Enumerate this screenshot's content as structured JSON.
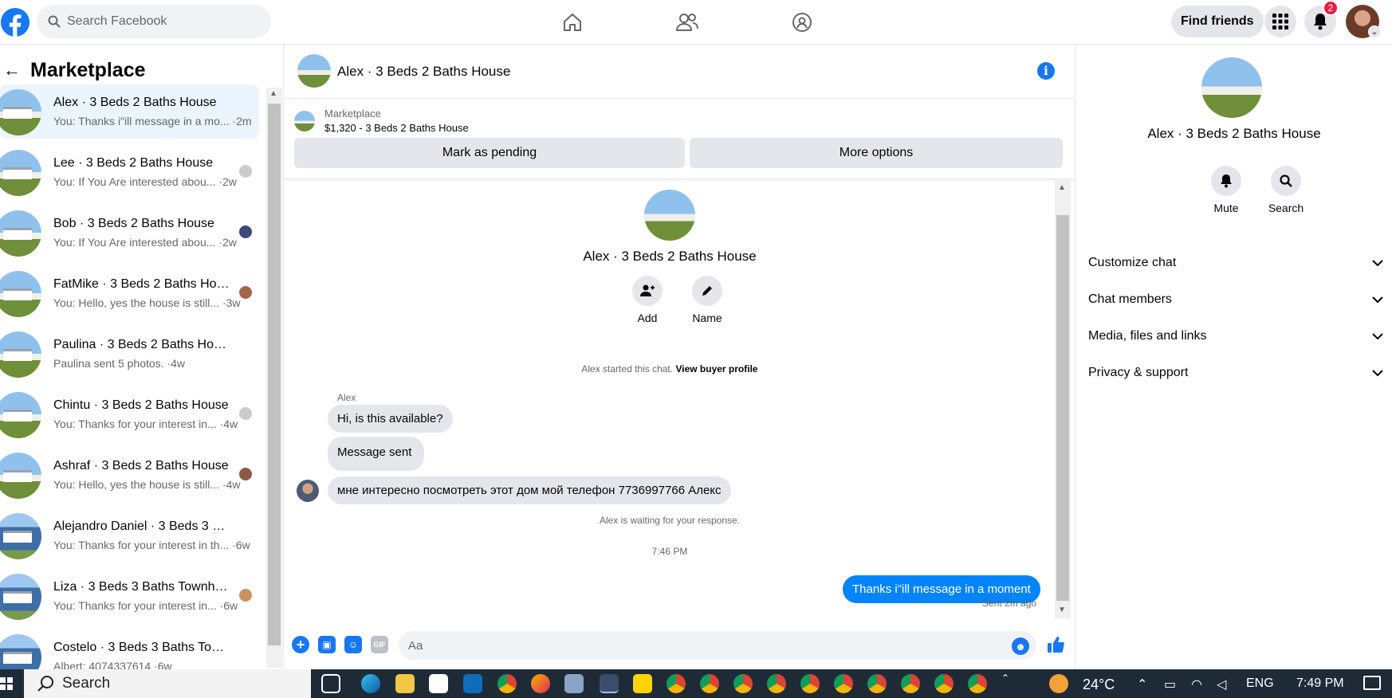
{
  "topbar": {
    "search_placeholder": "Search Facebook",
    "find_friends": "Find friends",
    "notification_count": "2"
  },
  "sidebar": {
    "title": "Marketplace",
    "conversations": [
      {
        "name": "Alex · 3 Beds 2 Baths House",
        "snippet": "You: Thanks i\"ill message in a mo... ·2m"
      },
      {
        "name": "Lee · 3 Beds 2 Baths House",
        "snippet": "You: If You Are interested abou... ·2w"
      },
      {
        "name": "Bob · 3 Beds 2 Baths House",
        "snippet": "You: If You Are interested abou... ·2w"
      },
      {
        "name": "FatMike · 3 Beds 2 Baths Hou...",
        "snippet": "You: Hello, yes the house is still... ·3w"
      },
      {
        "name": "Paulina · 3 Beds 2 Baths House",
        "snippet": "Paulina sent 5 photos. ·4w"
      },
      {
        "name": "Chintu · 3 Beds 2 Baths House",
        "snippet": "You: Thanks for your interest in... ·4w"
      },
      {
        "name": "Ashraf · 3 Beds 2 Baths House",
        "snippet": "You: Hello, yes the house is still... ·4w"
      },
      {
        "name": "Alejandro Daniel · 3 Beds 3 Bat...",
        "snippet": "You: Thanks for your interest in th... ·6w"
      },
      {
        "name": "Liza · 3 Beds 3 Baths Townho...",
        "snippet": "You: Thanks for your interest in... ·6w"
      },
      {
        "name": "Costelo · 3 Beds 3 Baths Townh...",
        "snippet": "Albert: 4074337614 ·6w"
      }
    ]
  },
  "chat": {
    "header_title": "Alex · 3 Beds 2 Baths House",
    "listing_category": "Marketplace",
    "listing_price_title": "$1,320 - 3 Beds 2 Baths House",
    "mark_pending": "Mark as pending",
    "more_options": "More options",
    "profile_name": "Alex · 3 Beds 2 Baths House",
    "add_label": "Add",
    "name_label": "Name",
    "started_text": "Alex started this chat.",
    "view_profile": "View buyer profile",
    "sender_name": "Alex",
    "messages": [
      "Hi, is this available?",
      "Message sent",
      "мне интересно посмотреть этот дом мой телефон 7736997766 Алекс"
    ],
    "waiting_text": "Alex is waiting for your response.",
    "timestamp": "7:46 PM",
    "my_message": "Thanks i\"ill message in a moment",
    "sent_status": "Sent 2m ago",
    "composer_placeholder": "Aa"
  },
  "details": {
    "name": "Alex · 3 Beds 2 Baths House",
    "mute": "Mute",
    "search": "Search",
    "sections": [
      "Customize chat",
      "Chat members",
      "Media, files and links",
      "Privacy & support"
    ]
  },
  "taskbar": {
    "search": "Search",
    "temperature": "24°C",
    "language": "ENG",
    "time": "7:49 PM"
  },
  "colors": {
    "accent": "#1877f2",
    "bubble_me": "#0084ff",
    "bubble_other": "#e4e6eb"
  }
}
